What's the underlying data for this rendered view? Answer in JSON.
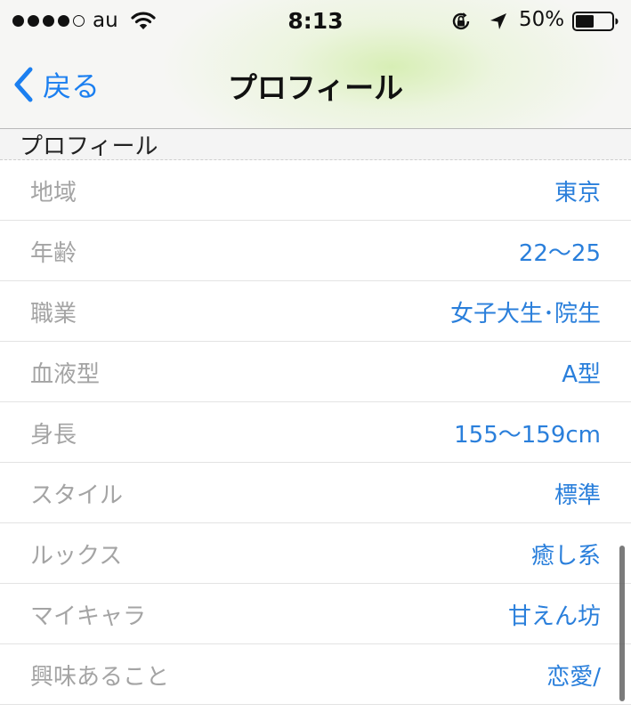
{
  "status_bar": {
    "carrier": "au",
    "time": "8:13",
    "battery_percent": "50%",
    "battery_level": 0.5,
    "signal_bars_filled": 4,
    "signal_bars_total": 5,
    "icons": [
      "wifi-icon",
      "orientation-lock-icon",
      "location-icon",
      "battery-icon"
    ]
  },
  "nav": {
    "back_label": "戻る",
    "title": "プロフィール",
    "icons": [
      "chevron-left-icon"
    ]
  },
  "section": {
    "title": "プロフィール"
  },
  "rows": [
    {
      "label": "地域",
      "value": "東京"
    },
    {
      "label": "年齢",
      "value": "22〜25"
    },
    {
      "label": "職業",
      "value": "女子大生･院生"
    },
    {
      "label": "血液型",
      "value": "A型"
    },
    {
      "label": "身長",
      "value": "155〜159cm"
    },
    {
      "label": "スタイル",
      "value": "標準"
    },
    {
      "label": "ルックス",
      "value": "癒し系"
    },
    {
      "label": "マイキャラ",
      "value": "甘えん坊"
    },
    {
      "label": "興味あること",
      "value": "恋愛/"
    }
  ],
  "colors": {
    "accent": "#1b7ff0",
    "value_text": "#2a7fdb",
    "label_text": "#a4a4a4"
  }
}
